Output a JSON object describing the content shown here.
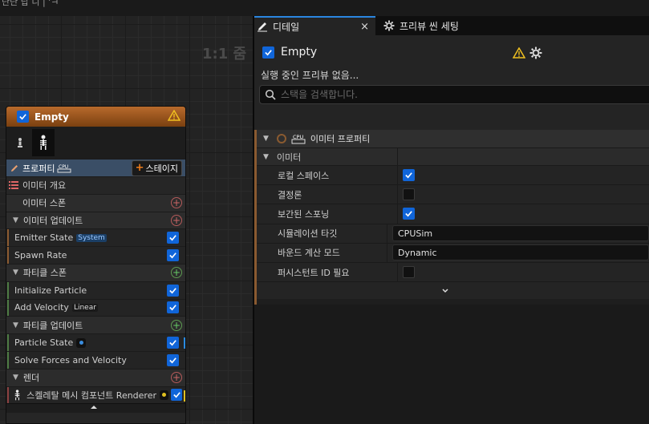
{
  "top_cut_text": "단단 답 니 | 'ㅋ",
  "graph": {
    "zoom": "1:1 줌",
    "node": {
      "title": "Empty",
      "properties_label": "프로퍼티",
      "cpu_badge": "CPU",
      "stage_button": "스테이지",
      "overview_label": "이미터 개요",
      "sections": [
        {
          "label": "이미터 스폰",
          "plus": "red",
          "modules": []
        },
        {
          "label": "이미터 업데이트",
          "plus": "red",
          "modules": [
            {
              "label": "Emitter State",
              "tag": "System",
              "checked": true
            },
            {
              "label": "Spawn Rate",
              "checked": true
            }
          ]
        },
        {
          "label": "파티클 스폰",
          "plus": "green",
          "modules": [
            {
              "label": "Initialize Particle",
              "checked": true
            },
            {
              "label": "Add Velocity",
              "tag": "Linear",
              "checked": true
            }
          ]
        },
        {
          "label": "파티클 업데이트",
          "plus": "green",
          "modules": [
            {
              "label": "Particle State",
              "checked": true
            },
            {
              "label": "Solve Forces and Velocity",
              "checked": true
            }
          ]
        },
        {
          "label": "렌더",
          "plus": "red",
          "modules": [
            {
              "label": "스켈레탈 메시 컴포넌트 Renderer",
              "checked": true
            }
          ]
        }
      ]
    }
  },
  "details": {
    "tab_details": "디테일",
    "tab_close": "×",
    "tab_preview": "프리뷰 씬 세팅",
    "title": "Empty",
    "subtitle": "실행 중인 프리뷰 없음...",
    "search_placeholder": "스택을 검색합니다.",
    "category": "이미터 프로퍼티",
    "subcategory": "이미터",
    "cpu_badge": "CPU",
    "properties": [
      {
        "name": "로컬 스페이스",
        "type": "check",
        "checked": true
      },
      {
        "name": "결정론",
        "type": "check",
        "checked": false
      },
      {
        "name": "보간된 스포닝",
        "type": "check",
        "checked": true
      },
      {
        "name": "시뮬레이션 타깃",
        "type": "combo",
        "value": "CPUSim"
      },
      {
        "name": "바운드 계산 모드",
        "type": "combo",
        "value": "Dynamic"
      },
      {
        "name": "퍼시스턴트 ID 필요",
        "type": "check",
        "checked": false
      }
    ]
  },
  "colors": {
    "accent_blue": "#1065d9",
    "node_header": "#b86a2c",
    "warning": "#f0c020"
  }
}
